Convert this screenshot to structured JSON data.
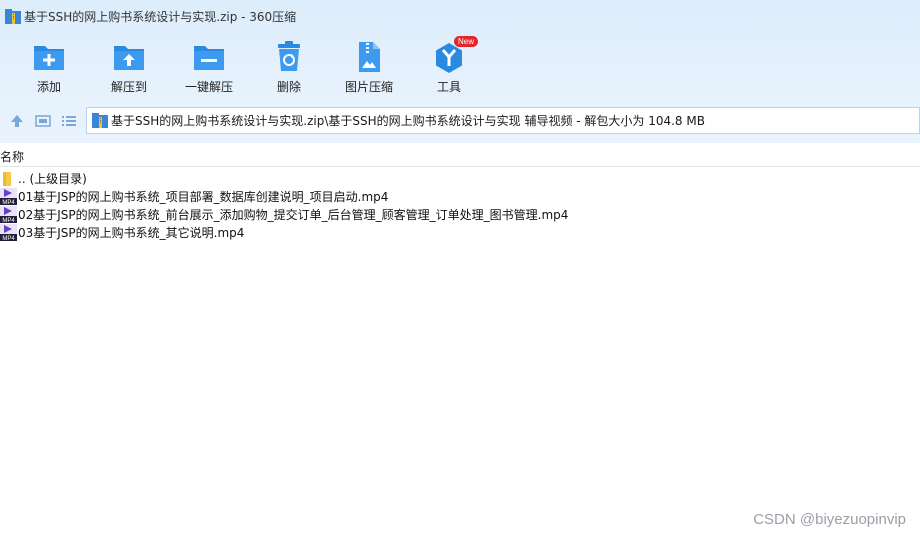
{
  "window": {
    "title": "基于SSH的网上购书系统设计与实现.zip - 360压缩",
    "app_icon": "zip-archive-icon"
  },
  "toolbar": {
    "buttons": [
      {
        "label": "添加",
        "icon": "add-folder-icon"
      },
      {
        "label": "解压到",
        "icon": "extract-folder-icon"
      },
      {
        "label": "一键解压",
        "icon": "one-click-extract-icon"
      },
      {
        "label": "删除",
        "icon": "recycle-bin-icon"
      },
      {
        "label": "图片压缩",
        "icon": "image-compress-icon"
      },
      {
        "label": "工具",
        "icon": "tools-icon",
        "badge": "New"
      }
    ]
  },
  "nav": {
    "path": "基于SSH的网上购书系统设计与实现.zip\\基于SSH的网上购书系统设计与实现 辅导视频 - 解包大小为 104.8 MB"
  },
  "columns": {
    "name": "名称"
  },
  "files": [
    {
      "name": ".. (上级目录)",
      "icon": "folder-icon"
    },
    {
      "name": "01基于JSP的网上购书系统_项目部署_数据库创建说明_项目启动.mp4",
      "icon": "mp4-video-icon"
    },
    {
      "name": "02基于JSP的网上购书系统_前台展示_添加购物_提交订单_后台管理_顾客管理_订单处理_图书管理.mp4",
      "icon": "mp4-video-icon"
    },
    {
      "name": "03基于JSP的网上购书系统_其它说明.mp4",
      "icon": "mp4-video-icon"
    }
  ],
  "watermark": "CSDN @biyezuopinvip",
  "colors": {
    "accent": "#2a8ae0",
    "toolbar_bg": "#e3f0fc",
    "badge": "#e3262b"
  }
}
